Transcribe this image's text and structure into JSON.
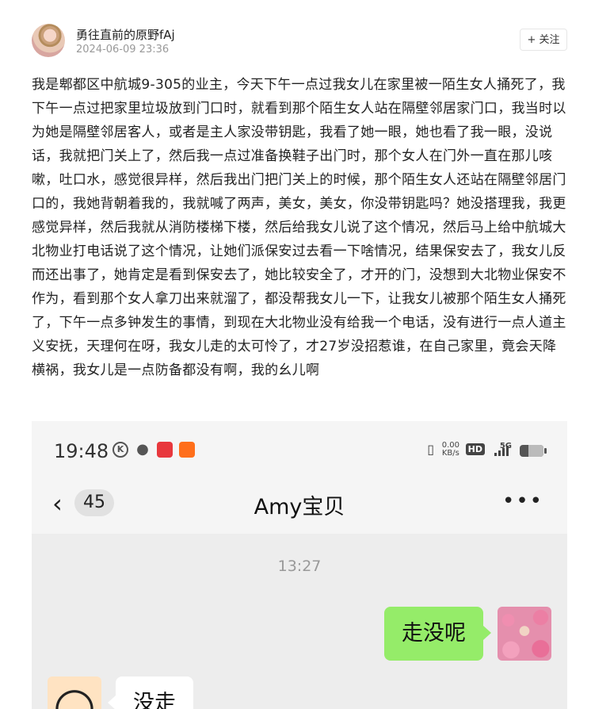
{
  "post": {
    "author_name": "勇往直前的原野fAj",
    "timestamp": "2024-06-09 23:36",
    "follow_label": "+ 关注",
    "text": "我是郫都区中航城9-305的业主，今天下午一点过我女儿在家里被一陌生女人捅死了，我下午一点过把家里垃圾放到门口时，就看到那个陌生女人站在隔壁邻居家门口，我当时以为她是隔壁邻居客人，或者是主人家没带钥匙，我看了她一眼，她也看了我一眼，没说话，我就把门关上了，然后我一点过准备换鞋子出门时，那个女人在门外一直在那儿咳嗽，吐口水，感觉很异样，然后我出门把门关上的时候，那个陌生女人还站在隔壁邻居门口的，我她背朝着我的，我就喊了两声，美女，美女，你没带钥匙吗？她没搭理我，我更感觉异样，然后我就从消防楼梯下楼，然后给我女儿说了这个情况，然后马上给中航城大北物业打电话说了这个情况，让她们派保安过去看一下啥情况，结果保安去了，我女儿反而还出事了，她肯定是看到保安去了，她比较安全了，才开的门，没想到大北物业保安不作为，看到那个女人拿刀出来就溜了，都没帮我女儿一下，让我女儿被那个陌生女人捅死了，下午一点多钟发生的事情，到现在大北物业没有给我一个电话，没有进行一点人道主义安抚，天理何在呀，我女儿走的太可怜了，才27岁没招惹谁，在自己家里，竟会天降横祸，我女儿是一点防备都没有啊，我的幺儿啊"
  },
  "screenshot": {
    "status_bar": {
      "time": "19:48",
      "k_icon_glyph": "K",
      "net_speed_value": "0.00",
      "net_speed_unit": "KB/s",
      "hd_label": "HD",
      "network_label": "5G",
      "battery_level": 0.35
    },
    "chat": {
      "back_glyph": "‹",
      "unread_count": "45",
      "title": "Amy宝贝",
      "more_glyph": "•••",
      "time_divider": "13:27",
      "messages": [
        {
          "side": "right",
          "text": "走没呢"
        },
        {
          "side": "left",
          "text": "没走"
        }
      ]
    },
    "colors": {
      "sent_bubble": "#95ec69",
      "received_bubble": "#ffffff",
      "chat_background": "#ededed"
    }
  }
}
